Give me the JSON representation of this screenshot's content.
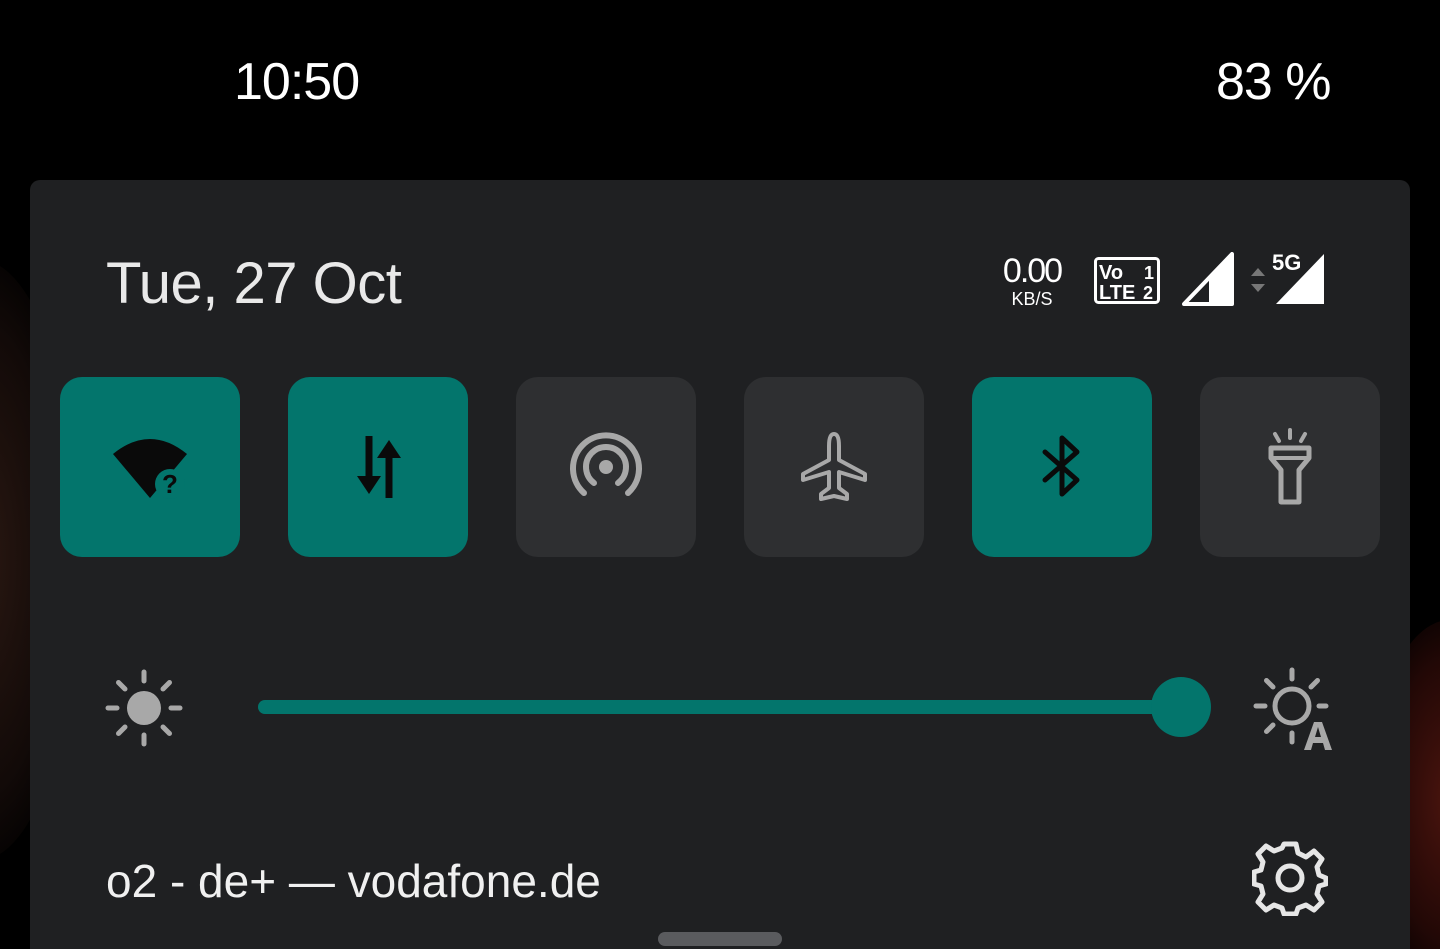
{
  "status_bar": {
    "time": "10:50",
    "battery": "83 %"
  },
  "header": {
    "date": "Tue, 27 Oct",
    "net_speed_value": "0.00",
    "net_speed_unit": "KB/S",
    "volte_line1": "Vo",
    "volte_line2": "LTE",
    "sim1": "1",
    "sim2": "2",
    "network_type": "5G"
  },
  "tiles": [
    {
      "name": "wifi",
      "icon": "wifi-question-icon",
      "state": "on"
    },
    {
      "name": "mobile-data",
      "icon": "data-transfer-icon",
      "state": "on"
    },
    {
      "name": "hotspot",
      "icon": "hotspot-icon",
      "state": "off"
    },
    {
      "name": "airplane-mode",
      "icon": "airplane-icon",
      "state": "off"
    },
    {
      "name": "bluetooth",
      "icon": "bluetooth-icon",
      "state": "on"
    },
    {
      "name": "flashlight",
      "icon": "flashlight-icon",
      "state": "off"
    }
  ],
  "brightness": {
    "level": 0.97,
    "low_icon": "sun-icon",
    "auto_icon": "auto-brightness-icon"
  },
  "footer": {
    "carrier": "o2 - de+ — vodafone.de",
    "settings_icon": "gear-icon"
  },
  "colors": {
    "accent": "#03756c",
    "tile_off": "#2e2f31",
    "panel": "#1f2022",
    "icon_off": "#a8a8a8"
  }
}
